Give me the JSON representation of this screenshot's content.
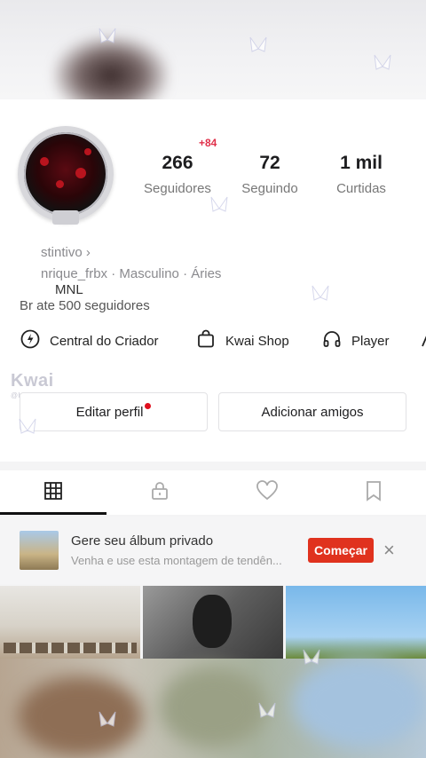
{
  "profile": {
    "stats": [
      {
        "value": "266",
        "label": "Seguidores"
      },
      {
        "value": "72",
        "label": "Seguindo"
      },
      {
        "value": "1 mil",
        "label": "Curtidas"
      }
    ],
    "new_followers_badge": "+84",
    "distintivo": "stintivo ›",
    "details": "nrique_frbx · Masculino · Áries",
    "bio": "MNL",
    "milestone": "Br ate 500 seguidores"
  },
  "actions": {
    "creator_center": "Central do Criador",
    "shop": "Kwai Shop",
    "player": "Player"
  },
  "watermark": {
    "brand": "Kwai",
    "handle": "@henrique_frbx"
  },
  "buttons": {
    "edit_profile": "Editar perfil",
    "add_friends": "Adicionar amigos"
  },
  "banner": {
    "title": "Gere seu álbum privado",
    "subtitle": "Venha e use esta montagem de tendên...",
    "cta": "Começar",
    "close": "×"
  },
  "icons": [
    "creator-center-icon",
    "shop-bag-icon",
    "headphones-icon",
    "grid-icon",
    "lock-icon",
    "heart-icon",
    "bookmark-icon"
  ],
  "colors": {
    "accent": "#e0321e",
    "badge": "#e0304a"
  }
}
